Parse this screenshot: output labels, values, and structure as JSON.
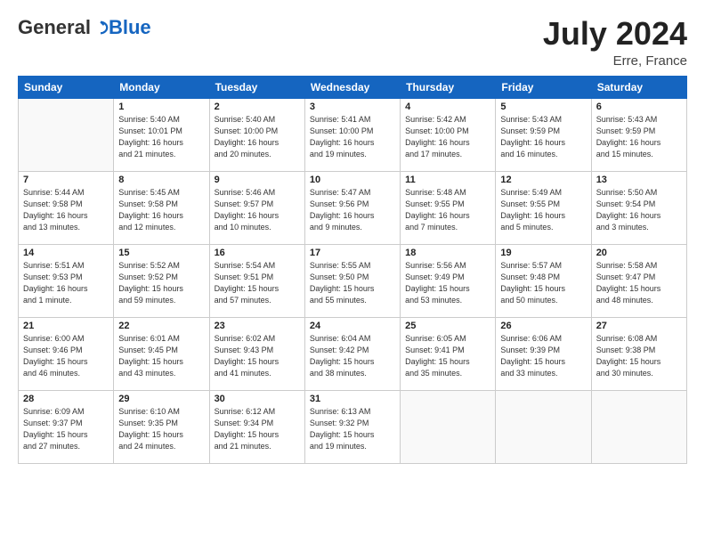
{
  "header": {
    "logo_general": "General",
    "logo_blue": "Blue",
    "title": "July 2024",
    "location": "Erre, France"
  },
  "days_of_week": [
    "Sunday",
    "Monday",
    "Tuesday",
    "Wednesday",
    "Thursday",
    "Friday",
    "Saturday"
  ],
  "weeks": [
    [
      {
        "day": "",
        "info": ""
      },
      {
        "day": "1",
        "info": "Sunrise: 5:40 AM\nSunset: 10:01 PM\nDaylight: 16 hours\nand 21 minutes."
      },
      {
        "day": "2",
        "info": "Sunrise: 5:40 AM\nSunset: 10:00 PM\nDaylight: 16 hours\nand 20 minutes."
      },
      {
        "day": "3",
        "info": "Sunrise: 5:41 AM\nSunset: 10:00 PM\nDaylight: 16 hours\nand 19 minutes."
      },
      {
        "day": "4",
        "info": "Sunrise: 5:42 AM\nSunset: 10:00 PM\nDaylight: 16 hours\nand 17 minutes."
      },
      {
        "day": "5",
        "info": "Sunrise: 5:43 AM\nSunset: 9:59 PM\nDaylight: 16 hours\nand 16 minutes."
      },
      {
        "day": "6",
        "info": "Sunrise: 5:43 AM\nSunset: 9:59 PM\nDaylight: 16 hours\nand 15 minutes."
      }
    ],
    [
      {
        "day": "7",
        "info": "Sunrise: 5:44 AM\nSunset: 9:58 PM\nDaylight: 16 hours\nand 13 minutes."
      },
      {
        "day": "8",
        "info": "Sunrise: 5:45 AM\nSunset: 9:58 PM\nDaylight: 16 hours\nand 12 minutes."
      },
      {
        "day": "9",
        "info": "Sunrise: 5:46 AM\nSunset: 9:57 PM\nDaylight: 16 hours\nand 10 minutes."
      },
      {
        "day": "10",
        "info": "Sunrise: 5:47 AM\nSunset: 9:56 PM\nDaylight: 16 hours\nand 9 minutes."
      },
      {
        "day": "11",
        "info": "Sunrise: 5:48 AM\nSunset: 9:55 PM\nDaylight: 16 hours\nand 7 minutes."
      },
      {
        "day": "12",
        "info": "Sunrise: 5:49 AM\nSunset: 9:55 PM\nDaylight: 16 hours\nand 5 minutes."
      },
      {
        "day": "13",
        "info": "Sunrise: 5:50 AM\nSunset: 9:54 PM\nDaylight: 16 hours\nand 3 minutes."
      }
    ],
    [
      {
        "day": "14",
        "info": "Sunrise: 5:51 AM\nSunset: 9:53 PM\nDaylight: 16 hours\nand 1 minute."
      },
      {
        "day": "15",
        "info": "Sunrise: 5:52 AM\nSunset: 9:52 PM\nDaylight: 15 hours\nand 59 minutes."
      },
      {
        "day": "16",
        "info": "Sunrise: 5:54 AM\nSunset: 9:51 PM\nDaylight: 15 hours\nand 57 minutes."
      },
      {
        "day": "17",
        "info": "Sunrise: 5:55 AM\nSunset: 9:50 PM\nDaylight: 15 hours\nand 55 minutes."
      },
      {
        "day": "18",
        "info": "Sunrise: 5:56 AM\nSunset: 9:49 PM\nDaylight: 15 hours\nand 53 minutes."
      },
      {
        "day": "19",
        "info": "Sunrise: 5:57 AM\nSunset: 9:48 PM\nDaylight: 15 hours\nand 50 minutes."
      },
      {
        "day": "20",
        "info": "Sunrise: 5:58 AM\nSunset: 9:47 PM\nDaylight: 15 hours\nand 48 minutes."
      }
    ],
    [
      {
        "day": "21",
        "info": "Sunrise: 6:00 AM\nSunset: 9:46 PM\nDaylight: 15 hours\nand 46 minutes."
      },
      {
        "day": "22",
        "info": "Sunrise: 6:01 AM\nSunset: 9:45 PM\nDaylight: 15 hours\nand 43 minutes."
      },
      {
        "day": "23",
        "info": "Sunrise: 6:02 AM\nSunset: 9:43 PM\nDaylight: 15 hours\nand 41 minutes."
      },
      {
        "day": "24",
        "info": "Sunrise: 6:04 AM\nSunset: 9:42 PM\nDaylight: 15 hours\nand 38 minutes."
      },
      {
        "day": "25",
        "info": "Sunrise: 6:05 AM\nSunset: 9:41 PM\nDaylight: 15 hours\nand 35 minutes."
      },
      {
        "day": "26",
        "info": "Sunrise: 6:06 AM\nSunset: 9:39 PM\nDaylight: 15 hours\nand 33 minutes."
      },
      {
        "day": "27",
        "info": "Sunrise: 6:08 AM\nSunset: 9:38 PM\nDaylight: 15 hours\nand 30 minutes."
      }
    ],
    [
      {
        "day": "28",
        "info": "Sunrise: 6:09 AM\nSunset: 9:37 PM\nDaylight: 15 hours\nand 27 minutes."
      },
      {
        "day": "29",
        "info": "Sunrise: 6:10 AM\nSunset: 9:35 PM\nDaylight: 15 hours\nand 24 minutes."
      },
      {
        "day": "30",
        "info": "Sunrise: 6:12 AM\nSunset: 9:34 PM\nDaylight: 15 hours\nand 21 minutes."
      },
      {
        "day": "31",
        "info": "Sunrise: 6:13 AM\nSunset: 9:32 PM\nDaylight: 15 hours\nand 19 minutes."
      },
      {
        "day": "",
        "info": ""
      },
      {
        "day": "",
        "info": ""
      },
      {
        "day": "",
        "info": ""
      }
    ]
  ]
}
